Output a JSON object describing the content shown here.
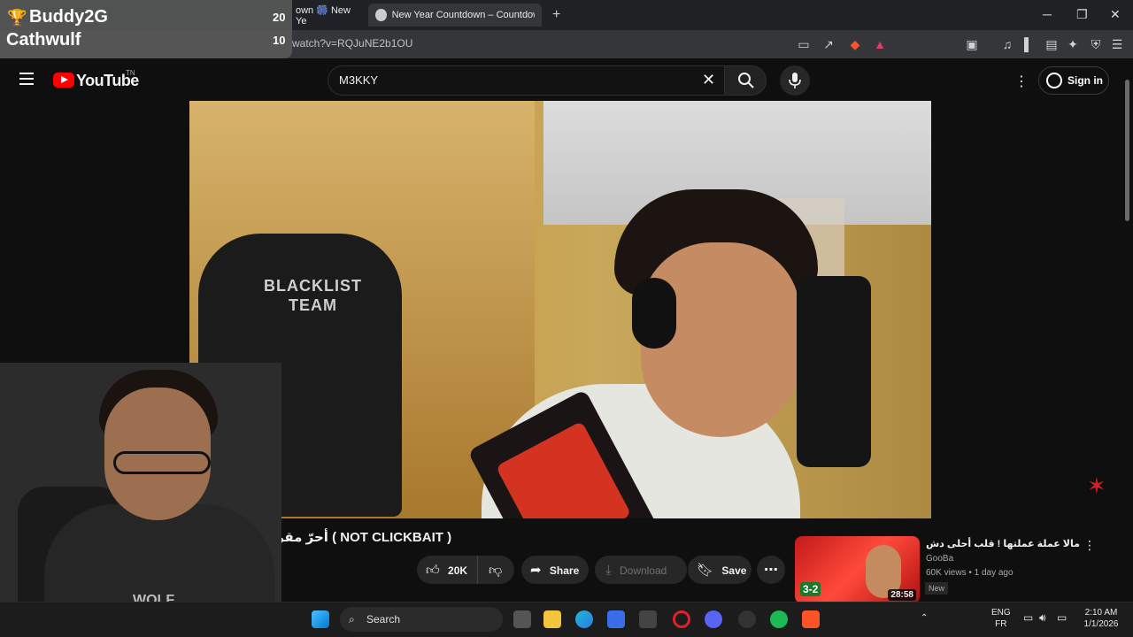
{
  "browser": {
    "tabs": [
      {
        "label": "own 🎆 New Ye"
      },
      {
        "label": "New Year Countdown – Countdown t"
      }
    ],
    "url_visible": "watch?v=RQJuNE2b1OU",
    "window_controls": [
      "─",
      "❐",
      "✕"
    ],
    "new_tab": "+"
  },
  "scoreboard": {
    "player1": "Buddy2G",
    "player2": "Cathwulf",
    "score1": "20",
    "score2": "10"
  },
  "youtube": {
    "logo_text": "YouTube",
    "country": "TN",
    "search_value": "M3KKY",
    "sign_in": "Sign in"
  },
  "video_frame": {
    "chair_text": "BLACKLIST\nTEAM"
  },
  "video": {
    "title": "أحرّ مقرونة ( NOT CLICKBAIT )",
    "likes": "20K",
    "share": "Share",
    "download": "Download",
    "save": "Save"
  },
  "webcam": {
    "shirt_text": "WOLF"
  },
  "recommendation": {
    "title": "مالا عملة عملتها ! قلب أحلى دش",
    "channel": "GooBa",
    "meta": "60K views • 1 day ago",
    "badge": "New",
    "duration": "28:58",
    "score": "3-2"
  },
  "taskbar": {
    "search": "Search",
    "lang_top": "ENG",
    "lang_bottom": "FR",
    "time": "2:10 AM",
    "date": "1/1/2026"
  },
  "colors": {
    "yt_red": "#ff0000",
    "bg": "#0f0f0f",
    "pill": "#272727"
  }
}
